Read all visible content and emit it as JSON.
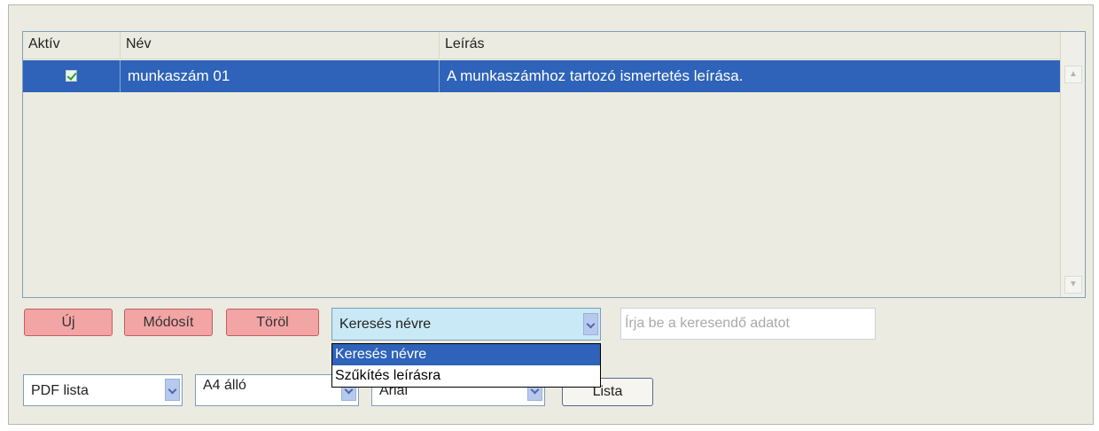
{
  "grid": {
    "columns": [
      "Aktív",
      "Név",
      "Leírás"
    ],
    "rows": [
      {
        "active": true,
        "name": "munkaszám 01",
        "description": "A munkaszámhoz tartozó ismertetés leírása."
      }
    ]
  },
  "toolbar": {
    "new_label": "Új",
    "modify_label": "Módosít",
    "delete_label": "Töröl",
    "search_mode": "Keresés névre",
    "search_placeholder": "Írja be a keresendő adatot"
  },
  "search_dropdown": {
    "options": [
      "Keresés névre",
      "Szűkítés leírásra"
    ],
    "selected_index": 0
  },
  "report": {
    "type": "PDF lista",
    "paper": "A4 álló",
    "font": "Arial",
    "list_label": "Lista"
  },
  "colors": {
    "selection": "#2e63b9",
    "action_button": "#f3a4a4",
    "panel_bg": "#ecebe1"
  }
}
